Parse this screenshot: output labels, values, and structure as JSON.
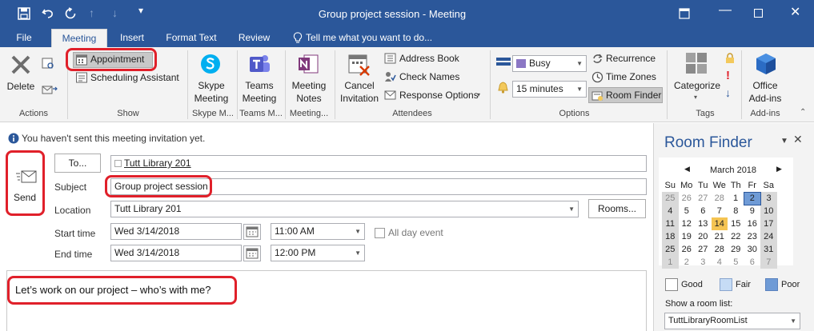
{
  "window": {
    "title": "Group project session - Meeting",
    "controls": [
      "restore-icon",
      "minimize-icon",
      "maximize-icon",
      "close-icon"
    ]
  },
  "tabs": [
    {
      "label": "File"
    },
    {
      "label": "Meeting"
    },
    {
      "label": "Insert"
    },
    {
      "label": "Format Text"
    },
    {
      "label": "Review"
    }
  ],
  "tellme": "Tell me what you want to do...",
  "ribbon": {
    "actions": {
      "delete": "Delete",
      "group": "Actions"
    },
    "show": {
      "appointment": "Appointment",
      "scheduling": "Scheduling Assistant",
      "group": "Show"
    },
    "skype": {
      "line1": "Skype",
      "line2": "Meeting",
      "group": "Skype M..."
    },
    "teams": {
      "line1": "Teams",
      "line2": "Meeting",
      "group": "Teams M..."
    },
    "meeting": {
      "line1": "Meeting",
      "line2": "Notes",
      "group": "Meeting..."
    },
    "attendees": {
      "cancel1": "Cancel",
      "cancel2": "Invitation",
      "address": "Address Book",
      "check": "Check Names",
      "response": "Response Options",
      "group": "Attendees"
    },
    "options": {
      "busy": "Busy",
      "reminder": "15 minutes",
      "recurrence": "Recurrence",
      "timezones": "Time Zones",
      "roomfinder": "Room Finder",
      "group": "Options"
    },
    "tags": {
      "categorize": "Categorize",
      "group": "Tags"
    },
    "addins": {
      "line1": "Office",
      "line2": "Add-ins",
      "group": "Add-ins"
    }
  },
  "form": {
    "info": "You haven't sent this meeting invitation yet.",
    "send": "Send",
    "to_button": "To...",
    "to_value": "Tutt Library 201",
    "subject_label": "Subject",
    "subject_value": "Group project session",
    "location_label": "Location",
    "location_value": "Tutt Library 201",
    "rooms_button": "Rooms...",
    "start_label": "Start time",
    "start_date": "Wed 3/14/2018",
    "start_time": "11:00 AM",
    "allday": "All day event",
    "end_label": "End time",
    "end_date": "Wed 3/14/2018",
    "end_time": "12:00 PM",
    "body": "Let’s work on our project – who’s with me?"
  },
  "roomfinder": {
    "title": "Room Finder",
    "month": "March 2018",
    "weekdays": [
      "Su",
      "Mo",
      "Tu",
      "We",
      "Th",
      "Fr",
      "Sa"
    ],
    "weeks": [
      [
        "25",
        "26",
        "27",
        "28",
        "1",
        "2",
        "3"
      ],
      [
        "4",
        "5",
        "6",
        "7",
        "8",
        "9",
        "10"
      ],
      [
        "11",
        "12",
        "13",
        "14",
        "15",
        "16",
        "17"
      ],
      [
        "18",
        "19",
        "20",
        "21",
        "22",
        "23",
        "24"
      ],
      [
        "25",
        "26",
        "27",
        "28",
        "29",
        "30",
        "31"
      ],
      [
        "1",
        "2",
        "3",
        "4",
        "5",
        "6",
        "7"
      ]
    ],
    "today": "14",
    "selected": "2",
    "legend": {
      "good": "Good",
      "fair": "Fair",
      "poor": "Poor"
    },
    "roomlist_label": "Show a room list:",
    "roomlist_value": "TuttLibraryRoomList",
    "colors": {
      "good": "#ffffff",
      "fair": "#c6dcf5",
      "poor": "#6f9bd6",
      "today": "#f5c452",
      "selected": "#6f9bd6"
    }
  },
  "colors": {
    "brand": "#2b579a",
    "highlight": "#e0202a"
  }
}
